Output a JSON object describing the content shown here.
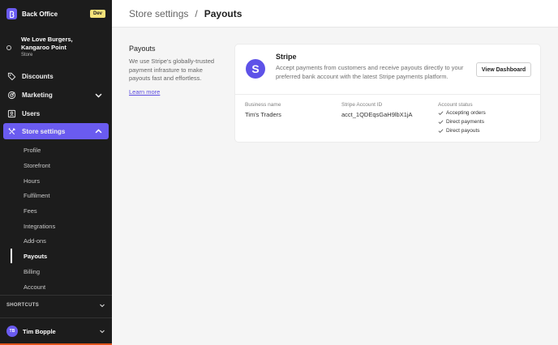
{
  "brand": {
    "name": "Back Office",
    "badge": "Dev"
  },
  "store": {
    "name_line1": "We Love Burgers,",
    "name_line2": "Kangaroo Point",
    "type": "Store"
  },
  "nav": {
    "discounts": "Discounts",
    "marketing": "Marketing",
    "users": "Users",
    "store_settings": "Store settings"
  },
  "subnav": [
    "Profile",
    "Storefront",
    "Hours",
    "Fulfilment",
    "Fees",
    "Integrations",
    "Add-ons",
    "Payouts",
    "Billing",
    "Account"
  ],
  "shortcuts": "SHORTCUTS",
  "user": {
    "initials": "TB",
    "name": "Tim Bopple"
  },
  "header": {
    "parent": "Store settings",
    "separator": "/",
    "current": "Payouts"
  },
  "intro": {
    "title": "Payouts",
    "description": "We use Stripe's globally-trusted payment infrasture to make payouts fast and effortless.",
    "link": "Learn more"
  },
  "card": {
    "logo_letter": "S",
    "title": "Stripe",
    "description": "Accept payments from customers and receive payouts directly to your preferred bank account with the latest Stripe payments platform.",
    "button": "View Dashboard",
    "business_name_label": "Business name",
    "business_name": "Tim's Traders",
    "account_id_label": "Stripe Account ID",
    "account_id": "acct_1QDEqsGaH9lbX1jA",
    "status_label": "Account status",
    "statuses": [
      "Accepting orders",
      "Direct payments",
      "Direct payouts"
    ]
  }
}
